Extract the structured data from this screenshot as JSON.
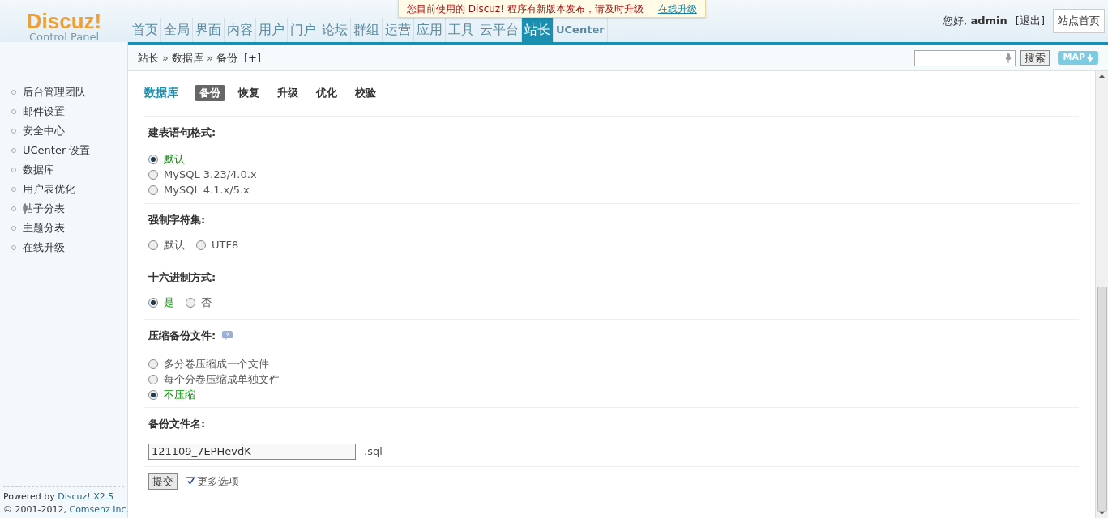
{
  "notice": {
    "text": "您目前使用的 Discuz! 程序有新版本发布，请及时升级",
    "link": "在线升级"
  },
  "logo": {
    "name": "Discuz!",
    "subtitle": "Control Panel"
  },
  "nav": [
    {
      "label": "首页",
      "selected": false
    },
    {
      "label": "全局",
      "selected": false
    },
    {
      "label": "界面",
      "selected": false
    },
    {
      "label": "内容",
      "selected": false
    },
    {
      "label": "用户",
      "selected": false
    },
    {
      "label": "门户",
      "selected": false
    },
    {
      "label": "论坛",
      "selected": false
    },
    {
      "label": "群组",
      "selected": false
    },
    {
      "label": "运营",
      "selected": false
    },
    {
      "label": "应用",
      "selected": false
    },
    {
      "label": "工具",
      "selected": false
    },
    {
      "label": "云平台",
      "selected": false
    },
    {
      "label": "站长",
      "selected": true
    },
    {
      "label": "UCenter",
      "selected": false
    }
  ],
  "user": {
    "greeting": "您好,",
    "name": "admin",
    "logout": "[退出]",
    "site_home": "站点首页"
  },
  "breadcrumb": {
    "items": [
      "站长",
      "数据库",
      "备份"
    ],
    "separator": "»",
    "add": "[+]"
  },
  "search": {
    "button": "搜索",
    "map": "MAP"
  },
  "sidebar": {
    "items": [
      "后台管理团队",
      "邮件设置",
      "安全中心",
      "UCenter 设置",
      "数据库",
      "用户表优化",
      "帖子分表",
      "主题分表",
      "在线升级"
    ]
  },
  "footer": [
    {
      "text": "Powered by",
      "link": "Discuz! X2.5"
    },
    {
      "text": "© 2001-2012,",
      "link": "Comsenz Inc."
    }
  ],
  "page": {
    "title": "数据库",
    "tabs": [
      {
        "label": "备份",
        "selected": true
      },
      {
        "label": "恢复",
        "selected": false
      },
      {
        "label": "升级",
        "selected": false
      },
      {
        "label": "优化",
        "selected": false
      },
      {
        "label": "校验",
        "selected": false
      }
    ]
  },
  "sections": [
    {
      "kind": "radio",
      "title": "建表语句格式:",
      "help": false,
      "inline": false,
      "options": [
        {
          "label": "默认",
          "selected": true
        },
        {
          "label": "MySQL 3.23/4.0.x",
          "selected": false
        },
        {
          "label": "MySQL 4.1.x/5.x",
          "selected": false
        }
      ]
    },
    {
      "kind": "radio",
      "title": "强制字符集:",
      "help": false,
      "inline": true,
      "options": [
        {
          "label": "默认",
          "selected": false
        },
        {
          "label": "UTF8",
          "selected": false
        }
      ]
    },
    {
      "kind": "radio",
      "title": "十六进制方式:",
      "help": false,
      "inline": true,
      "options": [
        {
          "label": "是",
          "selected": true
        },
        {
          "label": "否",
          "selected": false
        }
      ]
    },
    {
      "kind": "radio",
      "title": "压缩备份文件:",
      "help": true,
      "inline": false,
      "options": [
        {
          "label": "多分卷压缩成一个文件",
          "selected": false
        },
        {
          "label": "每个分卷压缩成单独文件",
          "selected": false
        },
        {
          "label": "不压缩",
          "selected": true
        }
      ]
    },
    {
      "kind": "filename",
      "title": "备份文件名:",
      "value": "121109_7EPHevdK",
      "suffix": ".sql"
    }
  ],
  "submit": {
    "label": "提交"
  },
  "more_options": {
    "label": "更多选项",
    "checked": true
  }
}
